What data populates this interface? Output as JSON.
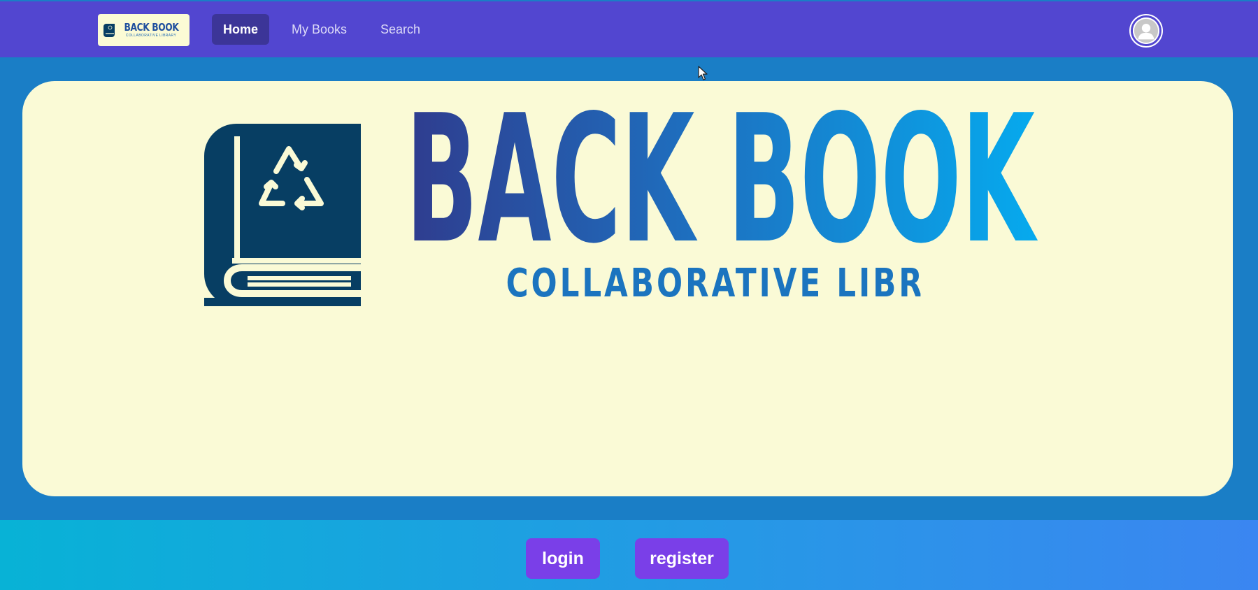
{
  "navbar": {
    "logo": {
      "title": "BACK BOOK",
      "subtitle": "COLLABORATIVE LIBRARY"
    },
    "links": [
      {
        "label": "Home",
        "active": true
      },
      {
        "label": "My Books",
        "active": false
      },
      {
        "label": "Search",
        "active": false
      }
    ],
    "avatar_icon": "user-avatar-icon"
  },
  "hero": {
    "title": "BACK BOOK",
    "subtitle": "COLLABORATIVE LIBRARY",
    "icon": "recycle-book-icon"
  },
  "footer": {
    "login_label": "login",
    "register_label": "register"
  },
  "colors": {
    "navbar": "#5246d0",
    "page_background": "#1a7ec6",
    "hero_background": "#fafad6",
    "button": "#7a3fe8",
    "footer_gradient_start": "#08b2d6",
    "footer_gradient_end": "#3b86f1"
  }
}
